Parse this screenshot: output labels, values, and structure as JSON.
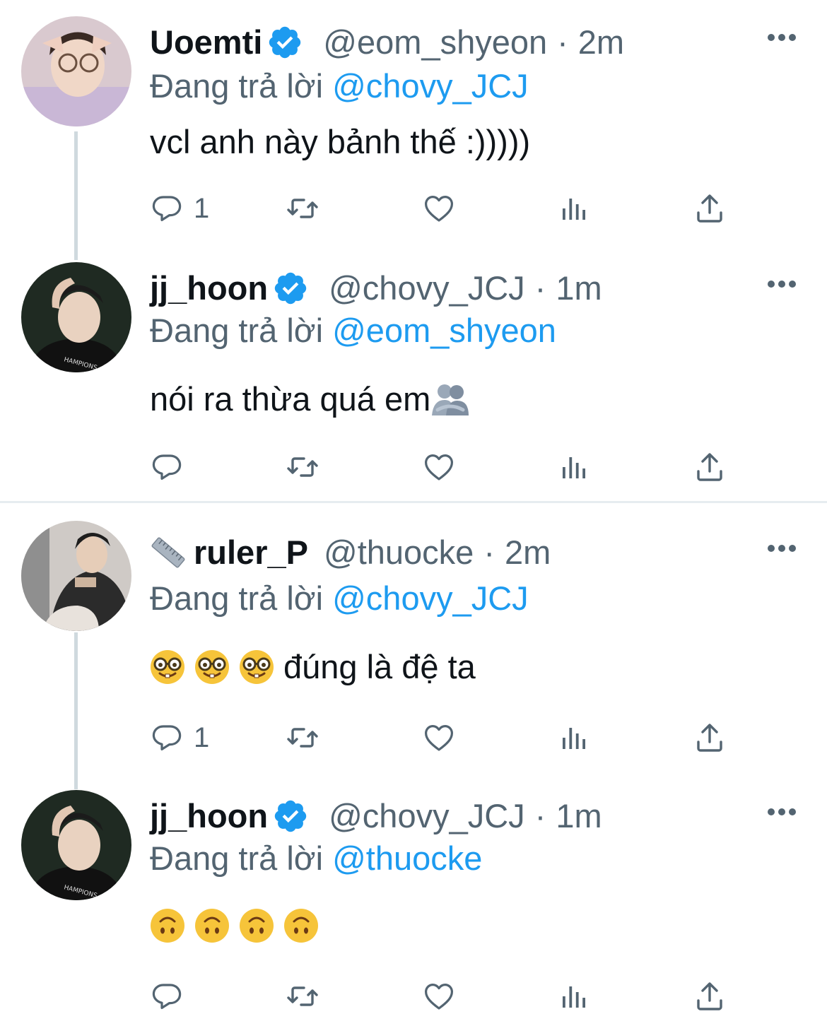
{
  "tweets": [
    {
      "name": "Uoemti",
      "verified": true,
      "handle": "@eom_shyeon",
      "time": "2m",
      "reply_prefix": "Đang trả lời",
      "reply_to": "@chovy_JCJ",
      "text": "vcl anh này bảnh thế :)))))",
      "reply_count": "1",
      "avatar_icon": "avatar-photo"
    },
    {
      "name": "jj_hoon",
      "verified": true,
      "handle": "@chovy_JCJ",
      "time": "1m",
      "reply_prefix": "Đang trả lời",
      "reply_to": "@eom_shyeon",
      "text": "nói ra thừa quá em",
      "text_emoji": "people-hugging-emoji",
      "reply_count": "",
      "avatar_icon": "avatar-photo"
    },
    {
      "name": "ruler_P",
      "name_icon": "ruler-emoji",
      "verified": false,
      "handle": "@thuocke",
      "time": "2m",
      "reply_prefix": "Đang trả lời",
      "reply_to": "@chovy_JCJ",
      "text": "đúng là đệ ta",
      "text_emoji": "nerd-face-emoji",
      "reply_count": "1",
      "avatar_icon": "avatar-photo"
    },
    {
      "name": "jj_hoon",
      "verified": true,
      "handle": "@chovy_JCJ",
      "time": "1m",
      "reply_prefix": "Đang trả lời",
      "reply_to": "@thuocke",
      "text": "",
      "text_emoji": "upside-down-face-emoji",
      "reply_count": "",
      "avatar_icon": "avatar-photo"
    }
  ],
  "separator": "·",
  "colors": {
    "accent": "#1d9bf0",
    "secondary_text": "#536471",
    "primary_text": "#0f1419",
    "thread_line": "#cfd9de"
  }
}
